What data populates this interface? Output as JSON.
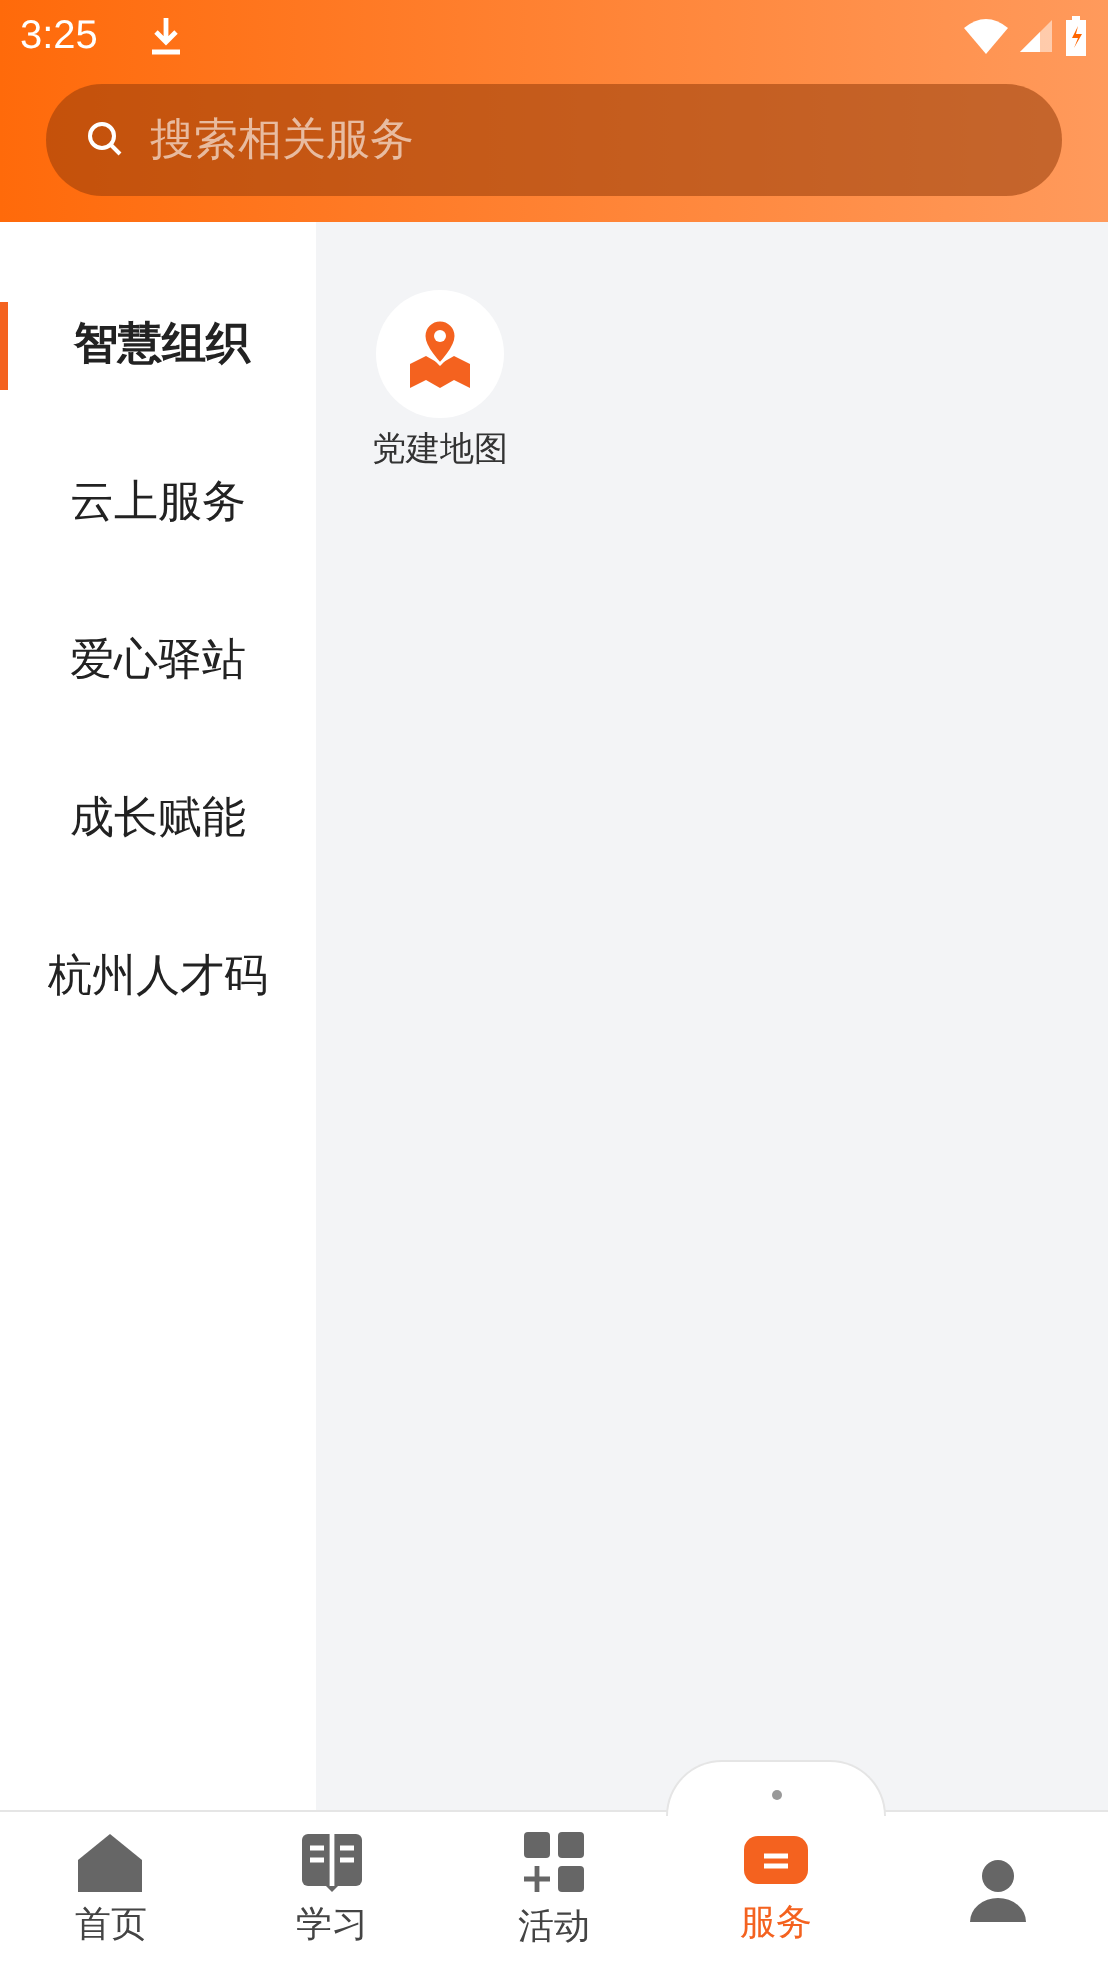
{
  "status_bar": {
    "time": "3:25"
  },
  "search": {
    "placeholder": "搜索相关服务"
  },
  "sidebar": {
    "items": [
      {
        "label": "智慧组织",
        "selected": true
      },
      {
        "label": "云上服务",
        "selected": false
      },
      {
        "label": "爱心驿站",
        "selected": false
      },
      {
        "label": "成长赋能",
        "selected": false
      },
      {
        "label": "杭州人才码",
        "selected": false
      }
    ]
  },
  "services": [
    {
      "label": "党建地图"
    }
  ],
  "tabs": [
    {
      "kind": "home",
      "label": "首页",
      "selected": false
    },
    {
      "kind": "study",
      "label": "学习",
      "selected": false
    },
    {
      "kind": "activity",
      "label": "活动",
      "selected": false
    },
    {
      "kind": "service",
      "label": "服务",
      "selected": true
    },
    {
      "kind": "profile",
      "selected": false
    }
  ]
}
